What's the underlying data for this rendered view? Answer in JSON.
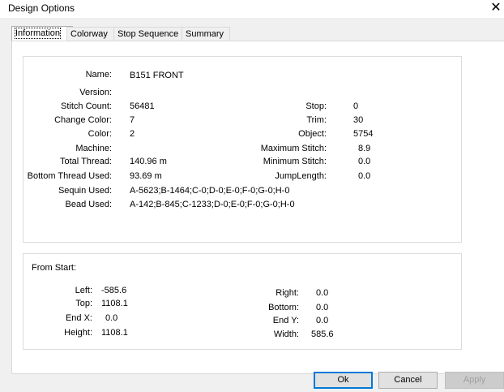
{
  "window": {
    "title": "Design Options",
    "close_glyph": "✕"
  },
  "tabs": [
    "Information",
    "Colorway",
    "Stop Sequence",
    "Summary"
  ],
  "info": {
    "name_label": "Name:",
    "name_value": "B151 FRONT",
    "version_label": "Version:",
    "version_value": "",
    "stitch_count_label": "Stitch Count:",
    "stitch_count_value": "56481",
    "change_color_label": "Change Color:",
    "change_color_value": "7",
    "color_label": "Color:",
    "color_value": "2",
    "machine_label": "Machine:",
    "machine_value": "",
    "total_thread_label": "Total Thread:",
    "total_thread_value": "140.96 m",
    "bottom_thread_label": "Bottom Thread Used:",
    "bottom_thread_value": "93.69 m",
    "sequin_label": "Sequin Used:",
    "sequin_value": "A-5623;B-1464;C-0;D-0;E-0;F-0;G-0;H-0",
    "bead_label": "Bead Used:",
    "bead_value": "A-142;B-845;C-1233;D-0;E-0;F-0;G-0;H-0",
    "stop_label": "Stop:",
    "stop_value": "0",
    "trim_label": "Trim:",
    "trim_value": "30",
    "object_label": "Object:",
    "object_value": "5754",
    "max_stitch_label": "Maximum Stitch:",
    "max_stitch_value": "8.9",
    "min_stitch_label": "Minimum Stitch:",
    "min_stitch_value": "0.0",
    "jump_label": "JumpLength:",
    "jump_value": "0.0"
  },
  "from_start": {
    "heading": "From Start:",
    "left_label": "Left:",
    "left_value": "-585.6",
    "top_label": "Top:",
    "top_value": "1108.1",
    "endx_label": "End X:",
    "endx_value": "0.0",
    "height_label": "Height:",
    "height_value": "1108.1",
    "right_label": "Right:",
    "right_value": "0.0",
    "bottom_label": "Bottom:",
    "bottom_value": "0.0",
    "endy_label": "End Y:",
    "endy_value": "0.0",
    "width_label": "Width:",
    "width_value": "585.6"
  },
  "buttons": {
    "ok": "Ok",
    "cancel": "Cancel",
    "apply": "Apply"
  }
}
